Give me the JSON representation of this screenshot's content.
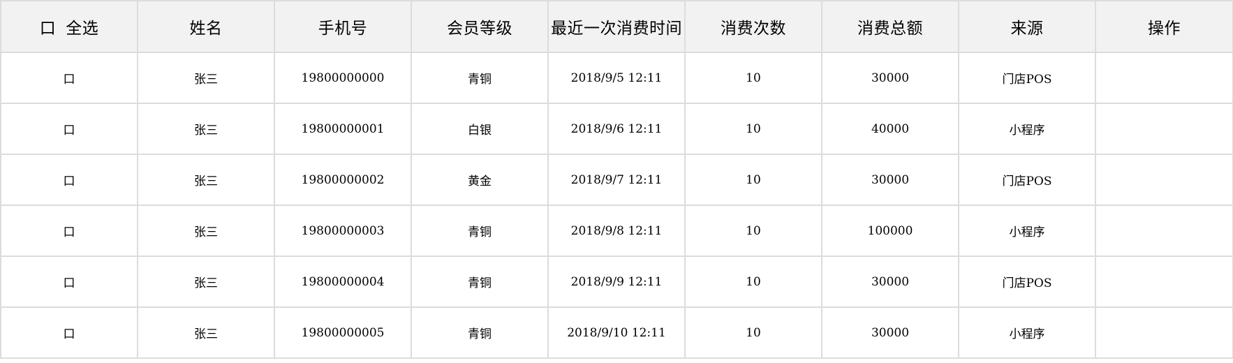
{
  "table": {
    "header": {
      "select_all_checkbox": "口",
      "select_all_label": "全选",
      "name": "姓名",
      "phone": "手机号",
      "level": "会员等级",
      "last_time": "最近一次消费时间",
      "count": "消费次数",
      "total": "消费总额",
      "source": "来源",
      "action": "操作"
    },
    "rows": [
      {
        "checkbox": "口",
        "name": "张三",
        "phone": "19800000000",
        "level": "青铜",
        "last_time": "2018/9/5 12:11",
        "count": "10",
        "total": "30000",
        "source": "门店POS",
        "action": ""
      },
      {
        "checkbox": "口",
        "name": "张三",
        "phone": "19800000001",
        "level": "白银",
        "last_time": "2018/9/6 12:11",
        "count": "10",
        "total": "40000",
        "source": "小程序",
        "action": ""
      },
      {
        "checkbox": "口",
        "name": "张三",
        "phone": "19800000002",
        "level": "黄金",
        "last_time": "2018/9/7 12:11",
        "count": "10",
        "total": "30000",
        "source": "门店POS",
        "action": ""
      },
      {
        "checkbox": "口",
        "name": "张三",
        "phone": "19800000003",
        "level": "青铜",
        "last_time": "2018/9/8 12:11",
        "count": "10",
        "total": "100000",
        "source": "小程序",
        "action": ""
      },
      {
        "checkbox": "口",
        "name": "张三",
        "phone": "19800000004",
        "level": "青铜",
        "last_time": "2018/9/9 12:11",
        "count": "10",
        "total": "30000",
        "source": "门店POS",
        "action": ""
      },
      {
        "checkbox": "口",
        "name": "张三",
        "phone": "19800000005",
        "level": "青铜",
        "last_time": "2018/9/10 12:11",
        "count": "10",
        "total": "30000",
        "source": "小程序",
        "action": ""
      }
    ]
  },
  "colors": {
    "header_bg": "#f2f2f2",
    "border": "#dcdcdc",
    "text": "#000000"
  }
}
